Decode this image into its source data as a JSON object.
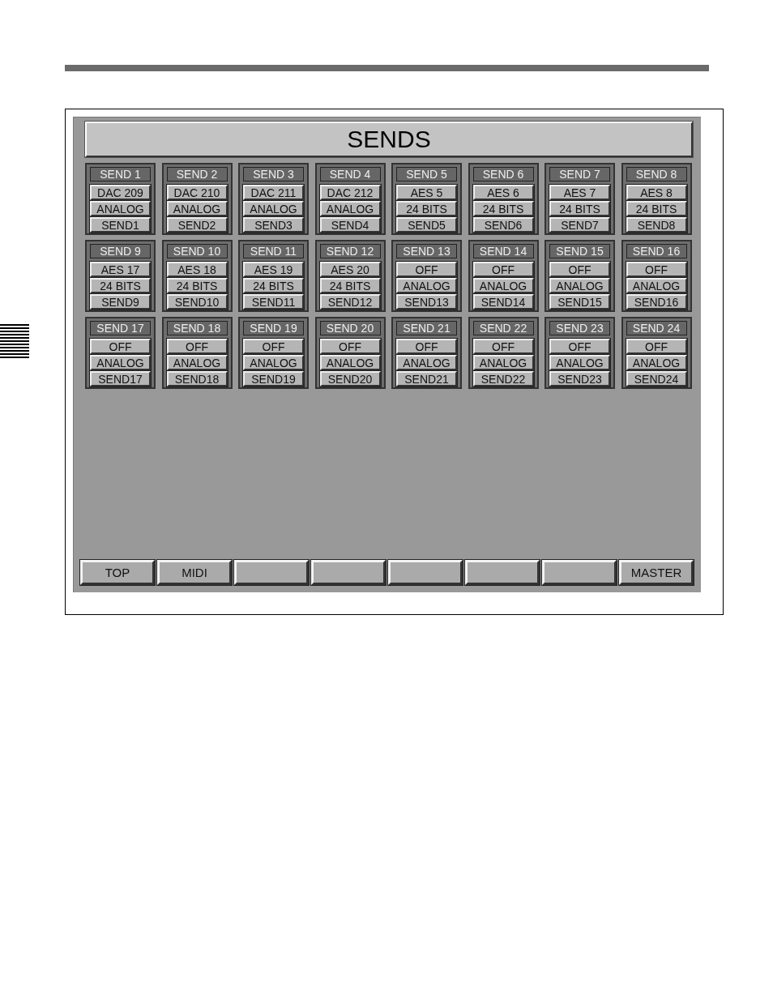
{
  "screen": {
    "title": "SENDS",
    "sends": [
      {
        "name": "SEND 1",
        "source": "DAC 209",
        "format": "ANALOG",
        "label": "SEND1"
      },
      {
        "name": "SEND 2",
        "source": "DAC 210",
        "format": "ANALOG",
        "label": "SEND2"
      },
      {
        "name": "SEND 3",
        "source": "DAC 211",
        "format": "ANALOG",
        "label": "SEND3"
      },
      {
        "name": "SEND 4",
        "source": "DAC 212",
        "format": "ANALOG",
        "label": "SEND4"
      },
      {
        "name": "SEND 5",
        "source": "AES 5",
        "format": "24 BITS",
        "label": "SEND5"
      },
      {
        "name": "SEND 6",
        "source": "AES 6",
        "format": "24 BITS",
        "label": "SEND6"
      },
      {
        "name": "SEND 7",
        "source": "AES 7",
        "format": "24 BITS",
        "label": "SEND7"
      },
      {
        "name": "SEND 8",
        "source": "AES 8",
        "format": "24 BITS",
        "label": "SEND8"
      },
      {
        "name": "SEND 9",
        "source": "AES 17",
        "format": "24 BITS",
        "label": "SEND9"
      },
      {
        "name": "SEND 10",
        "source": "AES 18",
        "format": "24 BITS",
        "label": "SEND10"
      },
      {
        "name": "SEND 11",
        "source": "AES 19",
        "format": "24 BITS",
        "label": "SEND11"
      },
      {
        "name": "SEND 12",
        "source": "AES 20",
        "format": "24 BITS",
        "label": "SEND12"
      },
      {
        "name": "SEND 13",
        "source": "OFF",
        "format": "ANALOG",
        "label": "SEND13"
      },
      {
        "name": "SEND 14",
        "source": "OFF",
        "format": "ANALOG",
        "label": "SEND14"
      },
      {
        "name": "SEND 15",
        "source": "OFF",
        "format": "ANALOG",
        "label": "SEND15"
      },
      {
        "name": "SEND 16",
        "source": "OFF",
        "format": "ANALOG",
        "label": "SEND16"
      },
      {
        "name": "SEND 17",
        "source": "OFF",
        "format": "ANALOG",
        "label": "SEND17"
      },
      {
        "name": "SEND 18",
        "source": "OFF",
        "format": "ANALOG",
        "label": "SEND18"
      },
      {
        "name": "SEND 19",
        "source": "OFF",
        "format": "ANALOG",
        "label": "SEND19"
      },
      {
        "name": "SEND 20",
        "source": "OFF",
        "format": "ANALOG",
        "label": "SEND20"
      },
      {
        "name": "SEND 21",
        "source": "OFF",
        "format": "ANALOG",
        "label": "SEND21"
      },
      {
        "name": "SEND 22",
        "source": "OFF",
        "format": "ANALOG",
        "label": "SEND22"
      },
      {
        "name": "SEND 23",
        "source": "OFF",
        "format": "ANALOG",
        "label": "SEND23"
      },
      {
        "name": "SEND 24",
        "source": "OFF",
        "format": "ANALOG",
        "label": "SEND24"
      }
    ],
    "buttons": [
      {
        "kind": "labeled",
        "label": "TOP"
      },
      {
        "kind": "labeled",
        "label": "MIDI"
      },
      {
        "kind": "blank"
      },
      {
        "kind": "blank"
      },
      {
        "kind": "blank"
      },
      {
        "kind": "blank"
      },
      {
        "kind": "blank"
      },
      {
        "kind": "labeled",
        "label": "MASTER"
      }
    ]
  }
}
